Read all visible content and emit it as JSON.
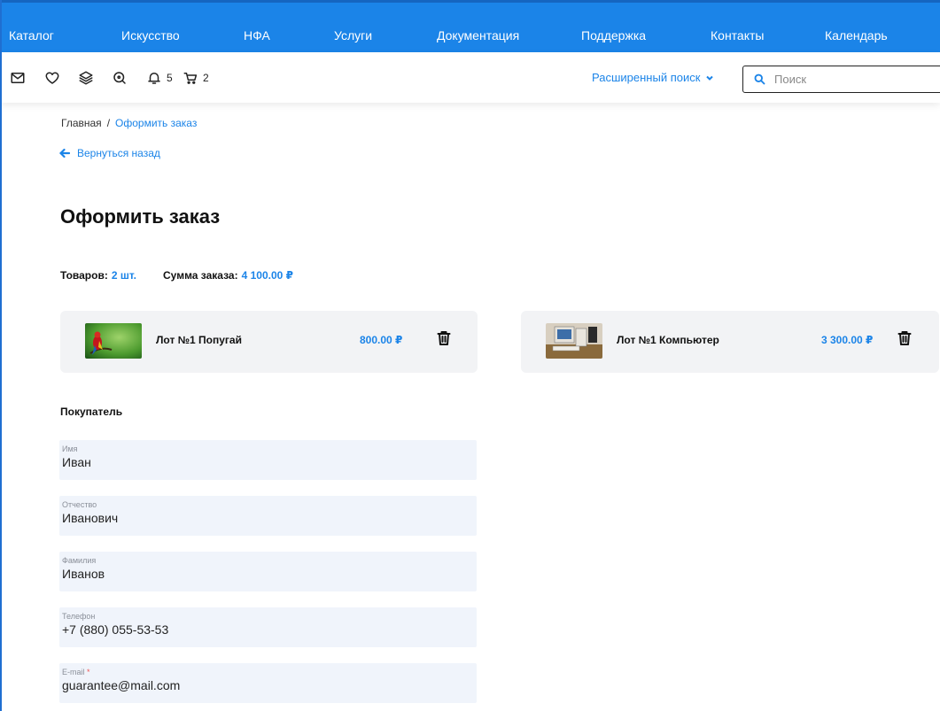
{
  "nav": {
    "items": [
      "Каталог",
      "Искусство",
      "НФА",
      "Услуги",
      "Документация",
      "Поддержка",
      "Контакты",
      "Календарь"
    ]
  },
  "toolbar": {
    "icons": [
      "mail-icon",
      "heart-icon",
      "layers-icon",
      "zoom-icon",
      "bell-icon",
      "cart-icon"
    ],
    "notifications_count": "5",
    "cart_count": "2",
    "advanced_search_label": "Расширенный поиск",
    "search_placeholder": "Поиск"
  },
  "breadcrumb": {
    "home": "Главная",
    "separator": "/",
    "current": "Оформить заказ"
  },
  "back_label": "Вернуться назад",
  "page_title": "Оформить заказ",
  "summary": {
    "items_label": "Товаров:",
    "items_value": "2 шт.",
    "sum_label": "Сумма заказа:",
    "sum_value": "4 100.00 ₽"
  },
  "cart": [
    {
      "name": "Лот №1 Попугай",
      "price": "800.00 ₽"
    },
    {
      "name": "Лот №1 Компьютер",
      "price": "3 300.00 ₽"
    }
  ],
  "buyer": {
    "title": "Покупатель",
    "fields": [
      {
        "label": "Имя",
        "value": "Иван",
        "required": false
      },
      {
        "label": "Отчество",
        "value": "Иванович",
        "required": false
      },
      {
        "label": "Фамилия",
        "value": "Иванов",
        "required": false
      },
      {
        "label": "Телефон",
        "value": "+7 (880) 055-53-53",
        "required": false
      },
      {
        "label": "E-mail",
        "value": "guarantee@mail.com",
        "required": true,
        "required_mark": "*"
      }
    ]
  },
  "colors": {
    "accent": "#1b84e8",
    "card_bg": "#f2f3f5",
    "field_bg": "#f0f4fb"
  }
}
